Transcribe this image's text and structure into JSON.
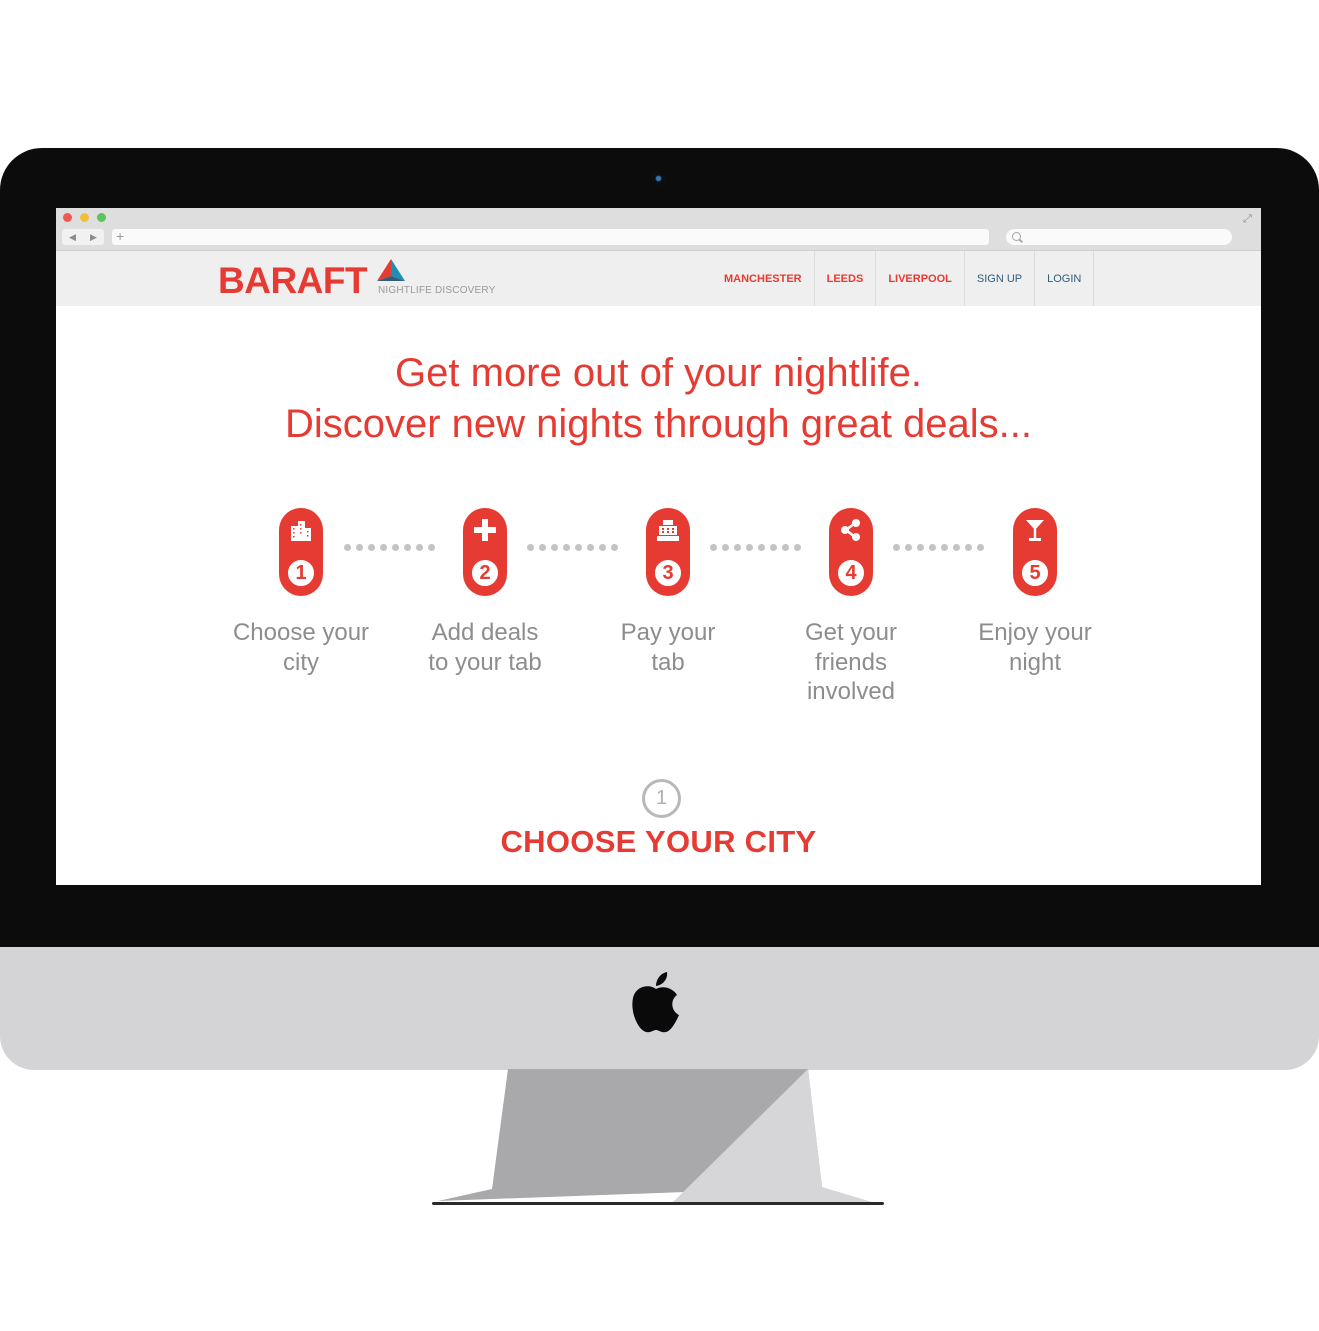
{
  "site": {
    "logo": "BARAFT",
    "tagline": "NIGHTLIFE DISCOVERY",
    "brand_color": "#e63b32",
    "nav": {
      "cities": [
        "MANCHESTER",
        "LEEDS",
        "LIVERPOOL"
      ],
      "sign_up": "SIGN UP",
      "login": "LOGIN"
    }
  },
  "hero": {
    "line1": "Get more out of your nightlife.",
    "line2": "Discover new nights through great deals..."
  },
  "steps": [
    {
      "number": "1",
      "icon": "city-buildings-icon",
      "label_lines": [
        "Choose your",
        "city"
      ]
    },
    {
      "number": "2",
      "icon": "plus-icon",
      "label_lines": [
        "Add deals",
        "to your tab"
      ]
    },
    {
      "number": "3",
      "icon": "cash-register-icon",
      "label_lines": [
        "Pay your",
        "tab"
      ]
    },
    {
      "number": "4",
      "icon": "share-icon",
      "label_lines": [
        "Get your",
        "friends",
        "involved"
      ]
    },
    {
      "number": "5",
      "icon": "cocktail-glass-icon",
      "label_lines": [
        "Enjoy your",
        "night"
      ]
    }
  ],
  "section": {
    "number": "1",
    "title": "CHOOSE YOUR CITY"
  }
}
